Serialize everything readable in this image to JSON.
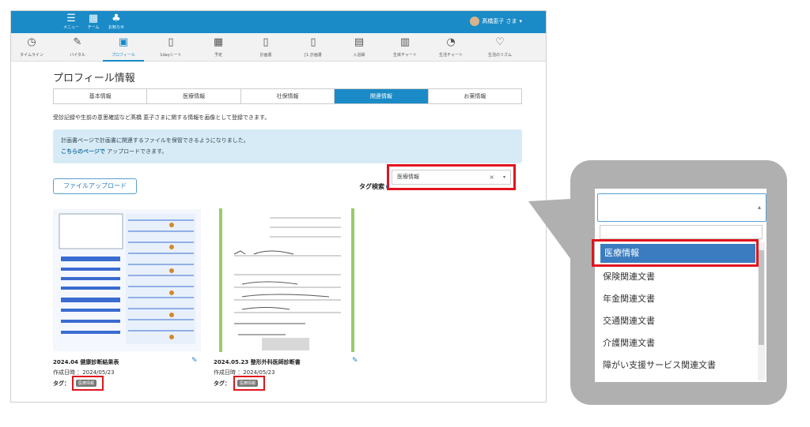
{
  "topbar": {
    "menu": "メニュー",
    "team": "チーム",
    "notice": "お知らせ",
    "user": "髙橋恵子 さま"
  },
  "nav": [
    {
      "icon": "clock-icon",
      "glyph": "◷",
      "label": "タイムライン"
    },
    {
      "icon": "pen-icon",
      "glyph": "✎",
      "label": "バイタル"
    },
    {
      "icon": "profile-icon",
      "glyph": "▣",
      "label": "プロフィール",
      "active": true
    },
    {
      "icon": "clipboard-icon",
      "glyph": "▯",
      "label": "1dayシート"
    },
    {
      "icon": "calendar-icon",
      "glyph": "▦",
      "label": "予定"
    },
    {
      "icon": "plan-icon",
      "glyph": "▯",
      "label": "計画書"
    },
    {
      "icon": "plan2-icon",
      "glyph": "▯",
      "label": "[1 計画書"
    },
    {
      "icon": "book-icon",
      "glyph": "▤",
      "label": "入浴録"
    },
    {
      "icon": "chart-icon",
      "glyph": "▥",
      "label": "生体チャート"
    },
    {
      "icon": "pie-icon",
      "glyph": "◔",
      "label": "生活チャート"
    },
    {
      "icon": "heart-icon",
      "glyph": "♡",
      "label": "生活のリズム"
    }
  ],
  "page_title": "プロフィール情報",
  "tabs": [
    "基本情報",
    "医療情報",
    "社保情報",
    "関連情報",
    "お薬情報"
  ],
  "description": "受診記録や生前の意思確認など髙橋 恵子さまに関する情報を画像として登録できます。",
  "info": {
    "line1": "計画書ページで計画書に関連するファイルを保管できるようになりました。",
    "link": "こちらのページで",
    "line2": " アップロードできます。"
  },
  "upload_label": "ファイルアップロード",
  "tag_search": {
    "label": "タグ検索",
    "value": "医療情報",
    "clear": "×",
    "arrow": "▾"
  },
  "cards": [
    {
      "title": "2024.04 健康診断結果表",
      "date_label": "作成日時 ：2024/05/23",
      "tag_label": "タグ：",
      "tag": "医療情報"
    },
    {
      "title": "2024.05.23 整形外科医師診断書",
      "date_label": "作成日時 ：2024/05/23",
      "tag_label": "タグ：",
      "tag": "医療情報"
    }
  ],
  "dropdown": {
    "options": [
      "医療情報",
      "保険関連文書",
      "年金関連文書",
      "交通関連文書",
      "介護関連文書",
      "障がい支援サービス関連文書"
    ]
  },
  "colors": {
    "primary": "#1a8bc7",
    "highlight": "#e0141e",
    "selected_option": "#3b7cc0"
  }
}
